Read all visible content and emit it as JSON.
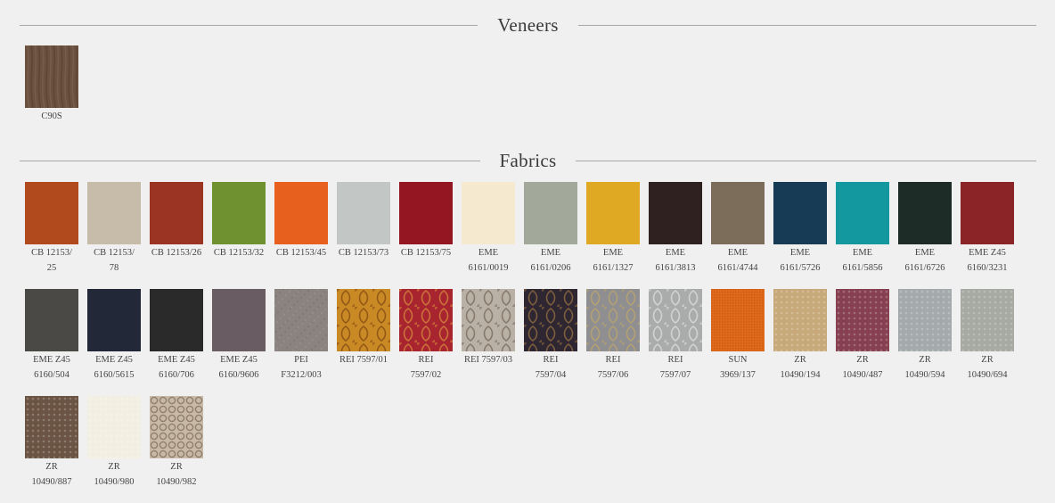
{
  "sections": {
    "veneers": {
      "title": "Veneers",
      "items": [
        {
          "lines": [
            "C90S"
          ],
          "color": "#6b5240",
          "pattern": "wood"
        }
      ]
    },
    "fabrics": {
      "title": "Fabrics",
      "rows": [
        [
          {
            "lines": [
              "CB 12153/",
              "25"
            ],
            "color": "#b14a1c"
          },
          {
            "lines": [
              "CB 12153/",
              "78"
            ],
            "color": "#c7bca9"
          },
          {
            "lines": [
              "CB 12153/26"
            ],
            "color": "#9c3424"
          },
          {
            "lines": [
              "CB 12153/32"
            ],
            "color": "#6f9130"
          },
          {
            "lines": [
              "CB 12153/45"
            ],
            "color": "#e8601d"
          },
          {
            "lines": [
              "CB 12153/73"
            ],
            "color": "#c2c6c5"
          },
          {
            "lines": [
              "CB 12153/75"
            ],
            "color": "#941622"
          },
          {
            "lines": [
              "EME",
              "6161/0019"
            ],
            "color": "#f5ead0"
          },
          {
            "lines": [
              "EME",
              "6161/0206"
            ],
            "color": "#a3a99a"
          },
          {
            "lines": [
              "EME",
              "6161/1327"
            ],
            "color": "#e0a923"
          },
          {
            "lines": [
              "EME",
              "6161/3813"
            ],
            "color": "#2f2120"
          },
          {
            "lines": [
              "EME",
              "6161/4744"
            ],
            "color": "#7c6c5a"
          },
          {
            "lines": [
              "EME",
              "6161/5726"
            ],
            "color": "#173a55"
          },
          {
            "lines": [
              "EME",
              "6161/5856"
            ],
            "color": "#14989f"
          },
          {
            "lines": [
              "EME",
              "6161/6726"
            ],
            "color": "#1d2c27"
          },
          {
            "lines": [
              "EME Z45",
              "6160/3231"
            ],
            "color": "#8b2426"
          }
        ],
        [
          {
            "lines": [
              "EME Z45",
              "6160/504"
            ],
            "color": "#4a4946"
          },
          {
            "lines": [
              "EME Z45",
              "6160/5615"
            ],
            "color": "#232838"
          },
          {
            "lines": [
              "EME Z45",
              "6160/706"
            ],
            "color": "#2a2a2b"
          },
          {
            "lines": [
              "EME Z45",
              "6160/9606"
            ],
            "color": "#6a5c63"
          },
          {
            "lines": [
              "PEI",
              "F3212/003"
            ],
            "color": "#8a8380",
            "pattern": "speckle"
          },
          {
            "lines": [
              "REI 7597/01"
            ],
            "color": "#c98a26",
            "pattern": "damask",
            "accent": "#8a4f12"
          },
          {
            "lines": [
              "REI",
              "7597/02"
            ],
            "color": "#a82530",
            "pattern": "damask",
            "accent": "#d0803a"
          },
          {
            "lines": [
              "REI 7597/03"
            ],
            "color": "#b9b1a5",
            "pattern": "damask",
            "accent": "#7d6f62"
          },
          {
            "lines": [
              "REI",
              "7597/04"
            ],
            "color": "#2e2630",
            "pattern": "damask",
            "accent": "#8a6840"
          },
          {
            "lines": [
              "REI",
              "7597/06"
            ],
            "color": "#8f8f91",
            "pattern": "damask",
            "accent": "#b9a36e"
          },
          {
            "lines": [
              "REI",
              "7597/07"
            ],
            "color": "#a9acab",
            "pattern": "damask",
            "accent": "#d8dad8"
          },
          {
            "lines": [
              "SUN",
              "3969/137"
            ],
            "color": "#e06a1c",
            "pattern": "weave"
          },
          {
            "lines": [
              "ZR",
              "10490/194"
            ],
            "color": "#c8a97a",
            "pattern": "dots"
          },
          {
            "lines": [
              "ZR",
              "10490/487"
            ],
            "color": "#874052",
            "pattern": "dots"
          },
          {
            "lines": [
              "ZR",
              "10490/594"
            ],
            "color": "#a4aaab",
            "pattern": "dots"
          },
          {
            "lines": [
              "ZR",
              "10490/694"
            ],
            "color": "#a6aaa2",
            "pattern": "dots"
          }
        ],
        [
          {
            "lines": [
              "ZR",
              "10490/887"
            ],
            "color": "#6b5443",
            "pattern": "dots"
          },
          {
            "lines": [
              "ZR",
              "10490/980"
            ],
            "color": "#f2efe2",
            "pattern": "dots"
          },
          {
            "lines": [
              "ZR",
              "10490/982"
            ],
            "color": "#c7b9a6",
            "pattern": "rings"
          }
        ]
      ]
    }
  }
}
